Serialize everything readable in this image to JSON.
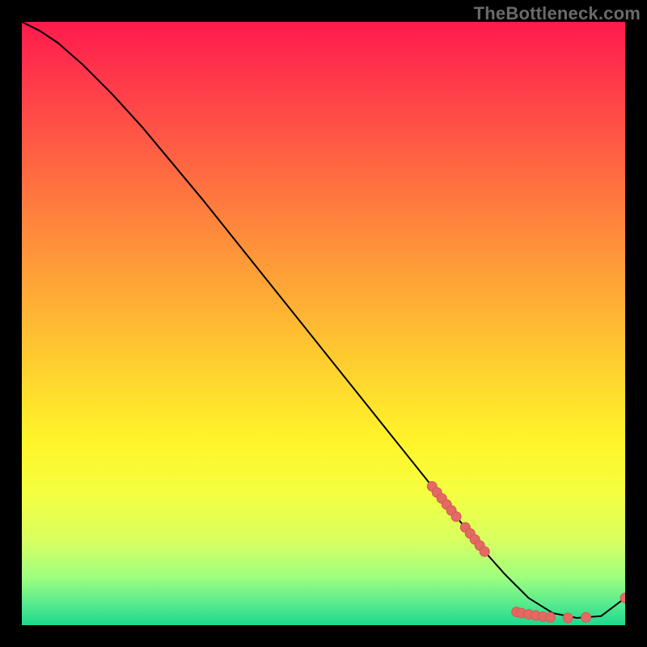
{
  "watermark": "TheBottleneck.com",
  "colors": {
    "background": "#000000",
    "line": "#000000",
    "marker_fill": "#e36a63",
    "marker_stroke": "#d15a54"
  },
  "chart_data": {
    "type": "line",
    "title": "",
    "xlabel": "",
    "ylabel": "",
    "xlim": [
      0,
      100
    ],
    "ylim": [
      0,
      100
    ],
    "grid": false,
    "legend": false,
    "series": [
      {
        "name": "curve",
        "x": [
          0,
          3,
          6,
          10,
          15,
          20,
          30,
          40,
          50,
          60,
          68,
          72,
          76,
          80,
          84,
          88,
          92,
          96,
          100
        ],
        "y": [
          100,
          98.5,
          96.5,
          93,
          88,
          82.5,
          70.5,
          58,
          45.5,
          33,
          23,
          18,
          13,
          8.5,
          4.5,
          2,
          1.2,
          1.5,
          4.5
        ]
      }
    ],
    "markers": [
      {
        "x": 68.0,
        "y": 23.0
      },
      {
        "x": 68.8,
        "y": 22.0
      },
      {
        "x": 69.6,
        "y": 21.0
      },
      {
        "x": 70.4,
        "y": 20.0
      },
      {
        "x": 71.2,
        "y": 19.0
      },
      {
        "x": 72.0,
        "y": 18.0
      },
      {
        "x": 73.5,
        "y": 16.2
      },
      {
        "x": 74.3,
        "y": 15.2
      },
      {
        "x": 75.1,
        "y": 14.2
      },
      {
        "x": 75.9,
        "y": 13.2
      },
      {
        "x": 76.7,
        "y": 12.2
      },
      {
        "x": 82.0,
        "y": 2.2
      },
      {
        "x": 82.8,
        "y": 2.0
      },
      {
        "x": 84.0,
        "y": 1.8
      },
      {
        "x": 85.2,
        "y": 1.6
      },
      {
        "x": 86.4,
        "y": 1.4
      },
      {
        "x": 87.6,
        "y": 1.3
      },
      {
        "x": 90.5,
        "y": 1.2
      },
      {
        "x": 93.5,
        "y": 1.3
      },
      {
        "x": 100.0,
        "y": 4.5
      }
    ]
  }
}
